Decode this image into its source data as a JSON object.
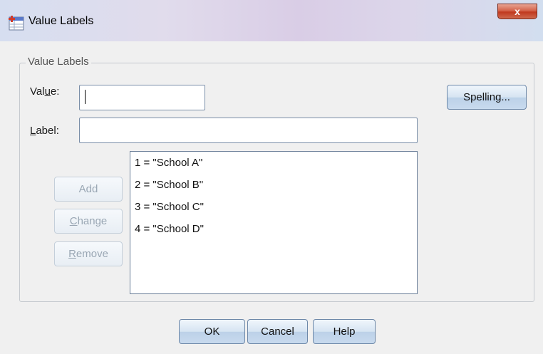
{
  "window": {
    "title": "Value Labels",
    "close_glyph": "x"
  },
  "group": {
    "legend": "Value Labels"
  },
  "value": {
    "label_pre": "Val",
    "label_mn": "u",
    "label_post": "e:",
    "input_value": ""
  },
  "label": {
    "label_mn": "L",
    "label_post": "abel:",
    "input_value": ""
  },
  "buttons": {
    "spelling": "Spelling...",
    "add": "Add",
    "change_mn": "C",
    "change_rest": "hange",
    "remove_mn": "R",
    "remove_rest": "emove",
    "ok": "OK",
    "cancel": "Cancel",
    "help": "Help"
  },
  "list": {
    "items": [
      "1 = \"School A\"",
      "2 = \"School B\"",
      "3 = \"School C\"",
      "4 = \"School D\""
    ]
  },
  "icons": {
    "window": "spss-value-labels-icon",
    "close": "close-icon"
  },
  "colors": {
    "close": "#c7452a",
    "button_border": "#6d88a8",
    "disabled_text": "#9aa7b4"
  }
}
